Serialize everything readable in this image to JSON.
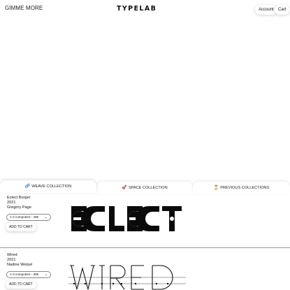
{
  "header": {
    "brand_left": "GIMME MORE",
    "logo": "TYPELAB",
    "account_label": "Account",
    "cart_label": "Cart"
  },
  "tabs": [
    {
      "icon": "🧬",
      "icon_name": "dna-icon",
      "label": "WEAVE COLLECTION"
    },
    {
      "icon": "🚀",
      "icon_name": "rocket-icon",
      "label": "SPACE COLLECTION"
    },
    {
      "icon": "⏳",
      "icon_name": "hourglass-icon",
      "label": "PREVIOUS COLLECTIONS"
    }
  ],
  "fonts": [
    {
      "name": "Eclect Burger",
      "year": "2021",
      "designer": "Gregory Page",
      "license_option": "1-3 computers - 40€",
      "add_label": "ADD TO CART",
      "preview_text": "ECLECT"
    },
    {
      "name": "Wired",
      "year": "2021",
      "designer": "Nadine Wetzel",
      "license_option": "1-3 computers - 30€",
      "add_label": "ADD TO CART",
      "preview_text": "WIRED"
    }
  ]
}
